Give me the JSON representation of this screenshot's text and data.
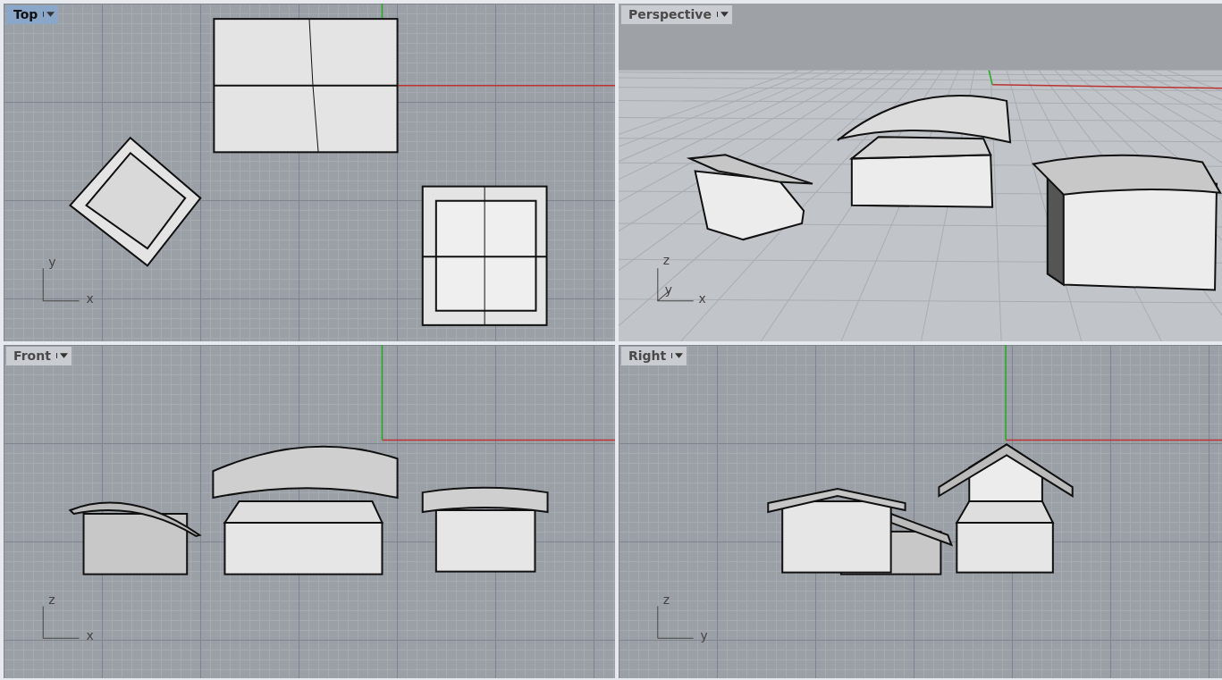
{
  "viewports": [
    {
      "kind": "top",
      "label": "Top",
      "selected": true,
      "axes": [
        "y",
        "x"
      ]
    },
    {
      "kind": "perspective",
      "label": "Perspective",
      "selected": false,
      "axes": [
        "z",
        "y",
        "x"
      ]
    },
    {
      "kind": "front",
      "label": "Front",
      "selected": false,
      "axes": [
        "z",
        "x"
      ]
    },
    {
      "kind": "right",
      "label": "Right",
      "selected": false,
      "axes": [
        "z",
        "y"
      ]
    }
  ]
}
